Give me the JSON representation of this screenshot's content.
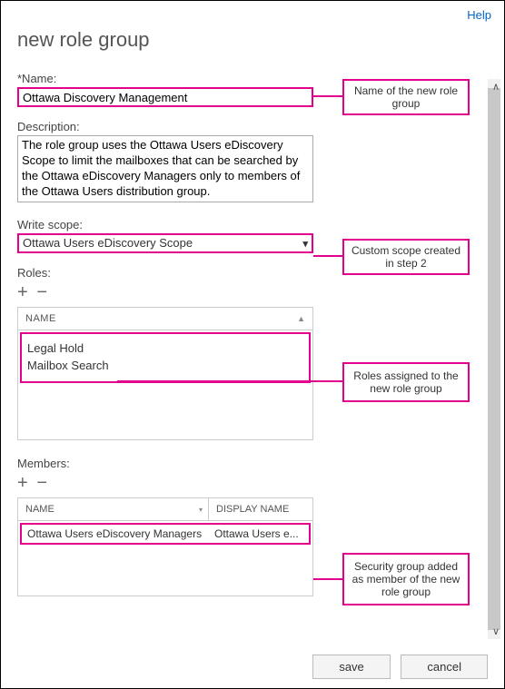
{
  "help": "Help",
  "title": "new role group",
  "fields": {
    "name_label": "*Name:",
    "name_value": "Ottawa Discovery Management",
    "desc_label": "Description:",
    "desc_value": "The role group uses the Ottawa Users eDiscovery Scope to limit the mailboxes that can be searched by the Ottawa eDiscovery Managers only to members of the Ottawa Users distribution group.",
    "scope_label": "Write scope:",
    "scope_value": "Ottawa Users eDiscovery Scope"
  },
  "roles": {
    "label": "Roles:",
    "col_name": "NAME",
    "items": [
      "Legal Hold",
      "Mailbox Search"
    ]
  },
  "members": {
    "label": "Members:",
    "col_name": "NAME",
    "col_display": "DISPLAY NAME",
    "row": {
      "name": "Ottawa Users eDiscovery Managers",
      "display": "Ottawa Users e..."
    }
  },
  "callouts": {
    "name": "Name of the new role group",
    "scope": "Custom scope created in step 2",
    "roles": "Roles assigned to the new role group",
    "members": "Security group added as member of the new role group"
  },
  "footer": {
    "save": "save",
    "cancel": "cancel"
  },
  "icons": {
    "plus": "+",
    "minus": "−",
    "caret_down": "▾",
    "sort": "▲",
    "mini": "▾"
  }
}
